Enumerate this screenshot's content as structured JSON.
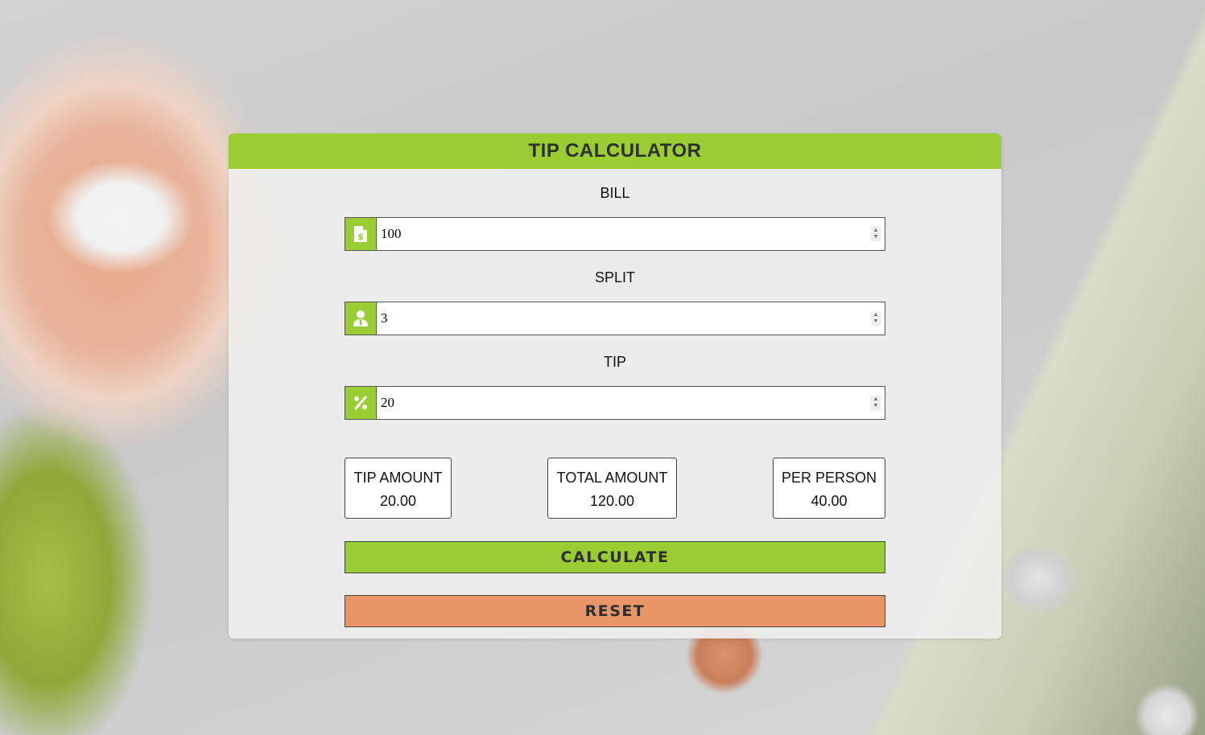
{
  "app": {
    "title": "TIP CALCULATOR"
  },
  "colors": {
    "accent": "#9acd32",
    "reset": "#e9956a"
  },
  "fields": {
    "bill": {
      "label": "BILL",
      "value": "100",
      "icon": "bill-dollar-icon"
    },
    "split": {
      "label": "SPLIT",
      "value": "3",
      "icon": "person-icon"
    },
    "tip": {
      "label": "TIP",
      "value": "20",
      "icon": "percent-icon"
    }
  },
  "results": {
    "tip_amount": {
      "label": "TIP AMOUNT",
      "value": "20.00"
    },
    "total_amount": {
      "label": "TOTAL AMOUNT",
      "value": "120.00"
    },
    "per_person": {
      "label": "PER PERSON",
      "value": "40.00"
    }
  },
  "buttons": {
    "calculate": "CALCULATE",
    "reset": "RESET"
  }
}
